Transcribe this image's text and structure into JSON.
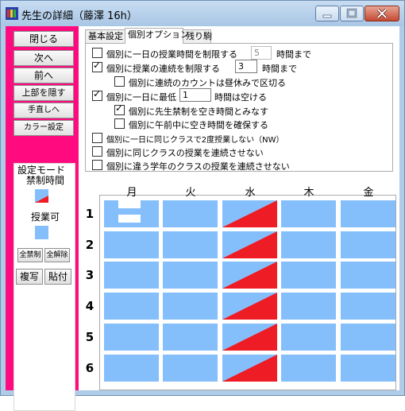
{
  "window": {
    "title": "先生の詳細（藤澤 16h）",
    "controls": {
      "minimize": "—",
      "maximize": "□",
      "close": "✕"
    }
  },
  "left_panel": {
    "buttons": [
      {
        "label": "閉じる"
      },
      {
        "label": "次へ"
      },
      {
        "label": "前へ"
      },
      {
        "label": "上部を隠す"
      },
      {
        "label": "手直しへ"
      },
      {
        "label": "カラー設定"
      }
    ],
    "setting_mode": {
      "title": "設定モード",
      "forbidden_label": "禁制時間",
      "available_label": "授業可",
      "all_forbid": "全禁制",
      "all_release": "全解除",
      "copy": "複写",
      "paste": "貼付"
    }
  },
  "tabs": [
    {
      "label": "基本設定",
      "active": false
    },
    {
      "label": "個別オプション",
      "active": true
    },
    {
      "label": "残り駒",
      "active": false
    }
  ],
  "options": [
    {
      "checked": false,
      "label": "個別に一日の授業時間を制限する",
      "value": "5",
      "suffix": "時間まで",
      "disabled": true
    },
    {
      "checked": true,
      "label": "個別に授業の連続を制限する",
      "value": "3",
      "suffix": "時間まで",
      "disabled": false
    },
    {
      "checked": false,
      "label": "個別に連続のカウントは昼休みで区切る"
    },
    {
      "checked": true,
      "label": "個別に一日に最低",
      "value": "1",
      "suffix": "時間は空ける",
      "disabled": false
    },
    {
      "checked": true,
      "label": "個別に先生禁制を空き時間とみなす"
    },
    {
      "checked": false,
      "label": "個別に午前中に空き時間を確保する"
    },
    {
      "checked": false,
      "label": "個別に一日に同じクラスで2度授業しない（NW）"
    },
    {
      "checked": false,
      "label": "個別に同じクラスの授業を連続させない"
    },
    {
      "checked": false,
      "label": "個別に違う学年のクラスの授業を連続させない"
    }
  ],
  "timetable": {
    "days": [
      "月",
      "火",
      "水",
      "木",
      "金"
    ],
    "periods": [
      "1",
      "2",
      "3",
      "4",
      "5",
      "6"
    ],
    "cells": [
      [
        "assigned",
        "available",
        "forbidden",
        "available",
        "available"
      ],
      [
        "available",
        "available",
        "forbidden",
        "available",
        "available"
      ],
      [
        "available",
        "available",
        "forbidden",
        "available",
        "available"
      ],
      [
        "available",
        "available",
        "forbidden",
        "available",
        "available"
      ],
      [
        "available",
        "available",
        "forbidden",
        "available",
        "available"
      ],
      [
        "available",
        "available",
        "forbidden",
        "available",
        "available"
      ]
    ]
  },
  "colors": {
    "available": "#85bffb",
    "forbidden": "#ee1c24",
    "panel": "#ff0a7f"
  }
}
